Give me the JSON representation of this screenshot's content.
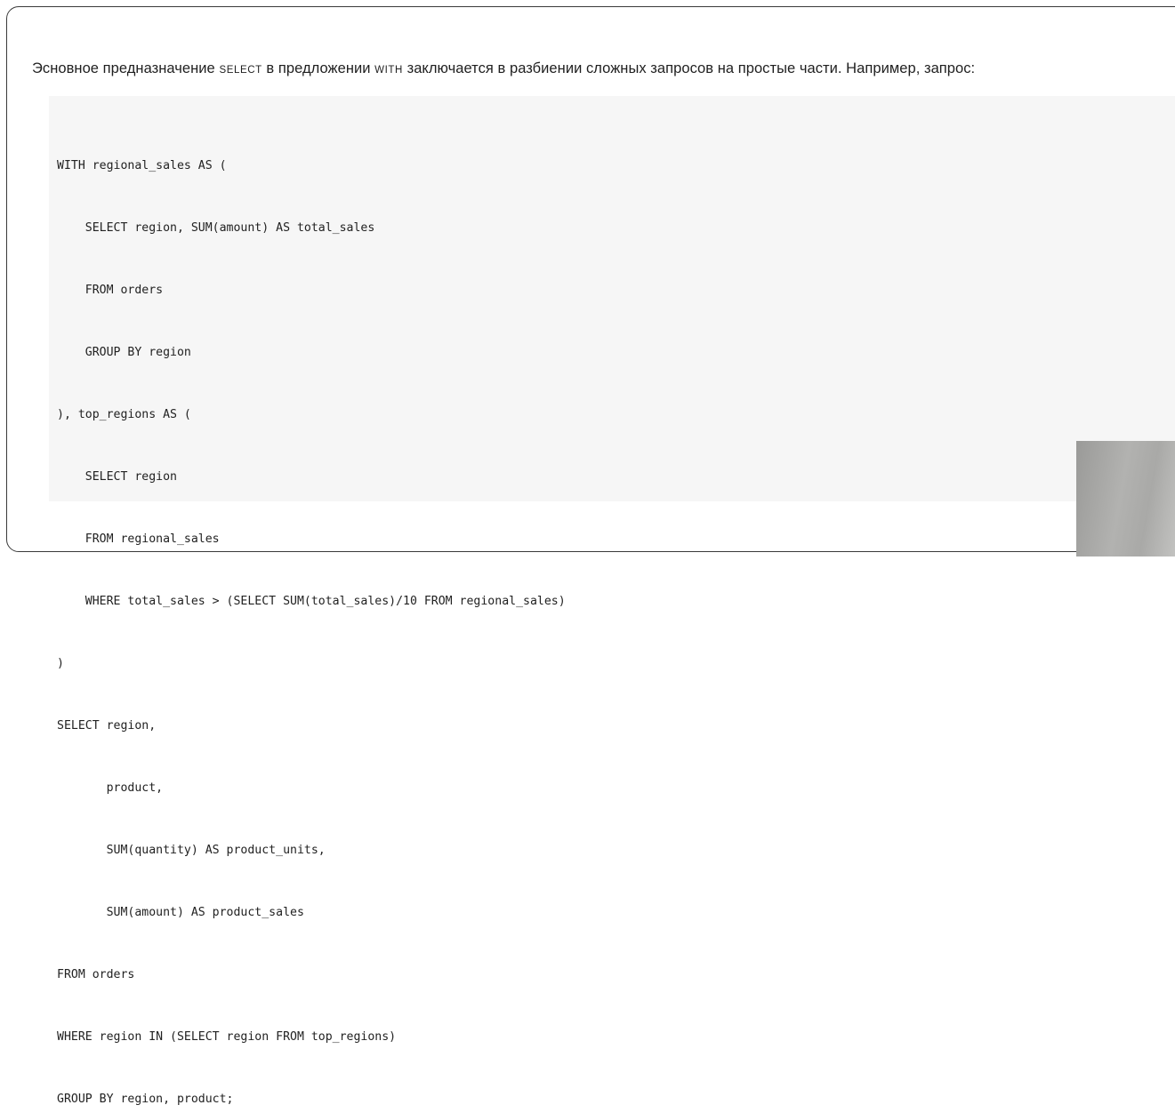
{
  "intro": {
    "part1": "Эсновное предназначение ",
    "kw1": "SELECT",
    "part2": " в предложении ",
    "kw2": "WITH",
    "part3": " заключается в разбиении сложных запросов на простые части. Например, запрос:"
  },
  "code": {
    "lines": [
      "WITH regional_sales AS (",
      "    SELECT region, SUM(amount) AS total_sales",
      "    FROM orders",
      "    GROUP BY region",
      "), top_regions AS (",
      "    SELECT region",
      "    FROM regional_sales",
      "    WHERE total_sales > (SELECT SUM(total_sales)/10 FROM regional_sales)",
      ")",
      "SELECT region,",
      "       product,",
      "       SUM(quantity) AS product_units,",
      "       SUM(amount) AS product_sales",
      "FROM orders",
      "WHERE region IN (SELECT region FROM top_regions)",
      "GROUP BY region, product;"
    ]
  },
  "colors": {
    "frame_border": "#3a3a3a",
    "code_background": "#f6f6f6",
    "text": "#1f1f1f"
  }
}
